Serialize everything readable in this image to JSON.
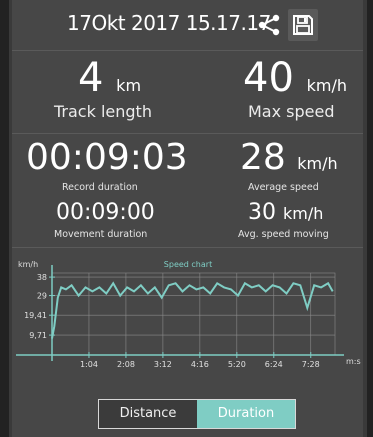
{
  "header": {
    "title": "17Okt 2017 15.17.17"
  },
  "stats": {
    "track_length": {
      "value": "4",
      "unit": "km",
      "label": "Track length"
    },
    "max_speed": {
      "value": "40",
      "unit": "km/h",
      "label": "Max speed"
    },
    "record_duration": {
      "value": "00:09:03",
      "label": "Record duration"
    },
    "average_speed": {
      "value": "28",
      "unit": "km/h",
      "label": "Average speed"
    },
    "movement_duration": {
      "value": "00:09:00",
      "label": "Movement duration"
    },
    "avg_speed_moving": {
      "value": "30",
      "unit": "km/h",
      "label": "Avg. speed moving"
    }
  },
  "chart_data": {
    "type": "line",
    "title": "Speed chart",
    "ylabel": "km/h",
    "xlabel": "m:s",
    "y_ticks": [
      "38",
      "29",
      "19,41",
      "9,71"
    ],
    "y_tick_values": [
      38,
      29,
      19.41,
      9.71
    ],
    "x_ticks": [
      "1:04",
      "2:08",
      "3:12",
      "4:16",
      "5:20",
      "6:24",
      "7:28"
    ],
    "xlim_seconds": [
      0,
      490
    ],
    "ylim": [
      0,
      40
    ],
    "x_seconds": [
      0,
      4,
      10,
      16,
      24,
      34,
      46,
      58,
      70,
      82,
      94,
      106,
      118,
      130,
      142,
      154,
      166,
      178,
      190,
      202,
      214,
      226,
      238,
      250,
      262,
      274,
      286,
      298,
      310,
      322,
      334,
      346,
      358,
      370,
      382,
      394,
      406,
      418,
      430,
      442,
      454,
      466,
      478,
      486
    ],
    "values": [
      8,
      14,
      28,
      33,
      32,
      34,
      29,
      33,
      31,
      33,
      30,
      35,
      29,
      33,
      31,
      34,
      30,
      33,
      28,
      34,
      35,
      31,
      34,
      32,
      33,
      30,
      35,
      33,
      32,
      29,
      35,
      33,
      34,
      31,
      34,
      33,
      30,
      35,
      34,
      23,
      34,
      33,
      35,
      31
    ],
    "colors": {
      "line": "#7fcdc4",
      "grid": "#8a8a8a",
      "axis": "#7fcdc4"
    }
  },
  "tabs": [
    {
      "label": "Distance",
      "active": false
    },
    {
      "label": "Duration",
      "active": true
    }
  ]
}
